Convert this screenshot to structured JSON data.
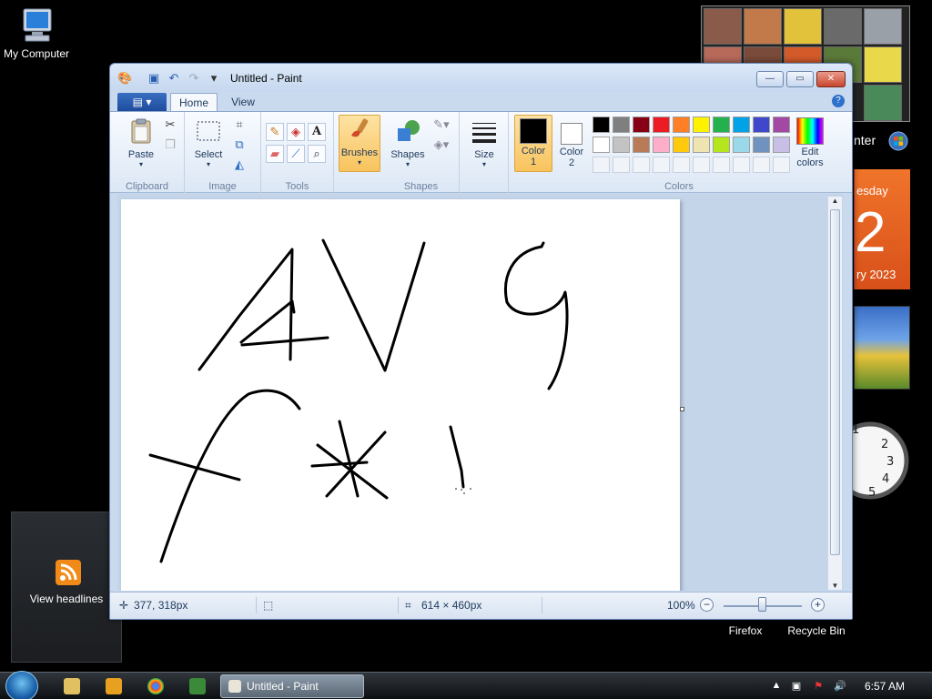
{
  "desktop": {
    "icons": [
      {
        "label": "My Computer"
      },
      {
        "label": "Firefox"
      },
      {
        "label": "Recycle Bin"
      }
    ],
    "gadgets": {
      "media_center_label": "nter",
      "calendar": {
        "day": "esday",
        "date": "2",
        "month": "ry 2023"
      },
      "feed_label": "View headlines"
    }
  },
  "window": {
    "title": "Untitled - Paint",
    "tabs": [
      "Home",
      "View"
    ],
    "groups": {
      "clipboard": {
        "label": "Clipboard",
        "paste": "Paste"
      },
      "image": {
        "label": "Image",
        "select": "Select"
      },
      "tools": {
        "label": "Tools"
      },
      "brushes": {
        "label": "Brushes"
      },
      "shapes": {
        "label": "Shapes",
        "button": "Shapes"
      },
      "size": {
        "label": "Size"
      },
      "colors": {
        "label": "Colors",
        "color1_line1": "Color",
        "color1_line2": "1",
        "color2_line1": "Color",
        "color2_line2": "2",
        "edit_line1": "Edit",
        "edit_line2": "colors",
        "color1_value": "#000000",
        "color2_value": "#ffffff",
        "palette_row1": [
          "#000000",
          "#7f7f7f",
          "#880015",
          "#ed1c24",
          "#ff7f27",
          "#fff200",
          "#22b14c",
          "#00a2e8",
          "#3f48cc",
          "#a349a4"
        ],
        "palette_row2": [
          "#ffffff",
          "#c3c3c3",
          "#b97a57",
          "#ffaec9",
          "#ffc90e",
          "#efe4b0",
          "#b5e61d",
          "#99d9ea",
          "#7092be",
          "#c8bfe7"
        ]
      }
    },
    "status": {
      "cursor_pos": "377, 318px",
      "canvas_size": "614 × 460px",
      "zoom": "100%"
    }
  },
  "taskbar": {
    "active_task": "Untitled - Paint",
    "clock": "6:57 AM"
  }
}
